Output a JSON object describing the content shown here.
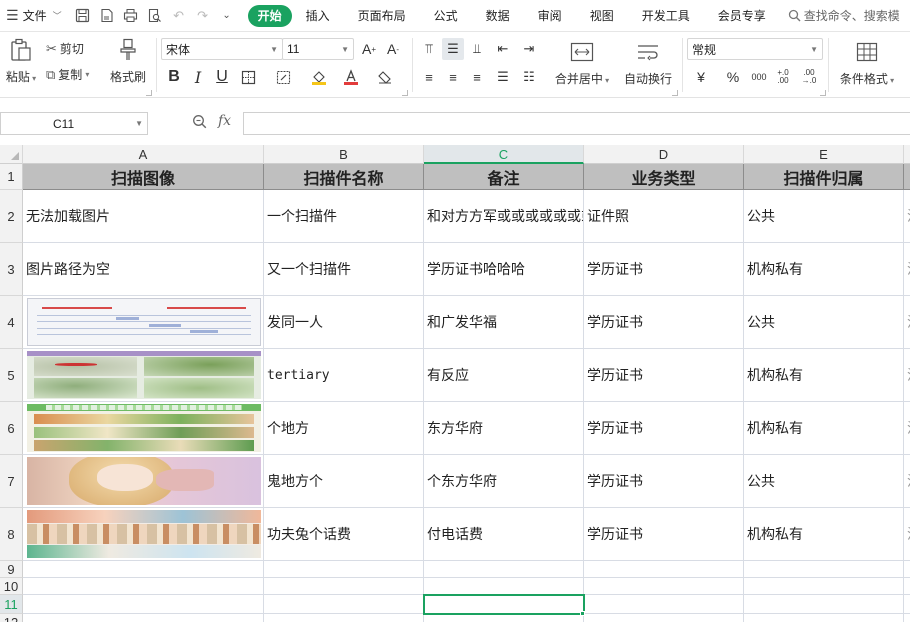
{
  "menubar": {
    "file_label": "文件",
    "tabs": [
      "开始",
      "插入",
      "页面布局",
      "公式",
      "数据",
      "审阅",
      "视图",
      "开发工具",
      "会员专享"
    ],
    "active_tab": "开始",
    "search_placeholder": "查找命令、搜索模"
  },
  "ribbon": {
    "paste": "粘贴",
    "cut": "剪切",
    "copy": "复制",
    "format_painter": "格式刷",
    "font_name": "宋体",
    "font_size": "11",
    "merge_center": "合并居中",
    "wrap_text": "自动换行",
    "number_format": "常规",
    "currency_symbol": "¥",
    "percent_symbol": "%",
    "thousands": "000",
    "increase_decimal": "+.0 .00",
    "decrease_decimal": ".00 →.0",
    "conditional_format": "条件格式"
  },
  "formula_bar": {
    "cell_reference": "C11",
    "fx_label": "fx",
    "formula": ""
  },
  "sheet": {
    "column_letters": [
      "A",
      "B",
      "C",
      "D",
      "E",
      ""
    ],
    "selected_column": "C",
    "row_numbers": [
      "1",
      "2",
      "3",
      "4",
      "5",
      "6",
      "7",
      "8",
      "9",
      "10",
      "11",
      "12"
    ],
    "selected_row": "11",
    "selected_cell": "C11",
    "headers": [
      "扫描图像",
      "扫描件名称",
      "备注",
      "业务类型",
      "扫描件归属"
    ],
    "rows": [
      {
        "image": "无法加载图片",
        "name": "一个扫描件",
        "note": "和对方方军或或或或或或或",
        "type": "证件照",
        "owner": "公共",
        "f": "注"
      },
      {
        "image": "图片路径为空",
        "name": "又一个扫描件",
        "note": "学历证书哈哈哈",
        "type": "学历证书",
        "owner": "机构私有",
        "f": "注"
      },
      {
        "image": "",
        "name": "发同一人",
        "note": "和广发华福",
        "type": "学历证书",
        "owner": "公共",
        "f": "注"
      },
      {
        "image": "",
        "name": "tertiary",
        "note": "有反应",
        "type": "学历证书",
        "owner": "机构私有",
        "f": "注"
      },
      {
        "image": "",
        "name": "个地方",
        "note": "东方华府",
        "type": "学历证书",
        "owner": "机构私有",
        "f": "注"
      },
      {
        "image": "",
        "name": "鬼地方个",
        "note": "个东方华府",
        "type": "学历证书",
        "owner": "公共",
        "f": "注"
      },
      {
        "image": "",
        "name": "功夫兔个话费",
        "note": "付电话费",
        "type": "学历证书",
        "owner": "机构私有",
        "f": "注"
      }
    ]
  },
  "colors": {
    "accent": "#1aa260",
    "header_fill": "#bfbfbf",
    "gridline": "#d8dce4"
  }
}
